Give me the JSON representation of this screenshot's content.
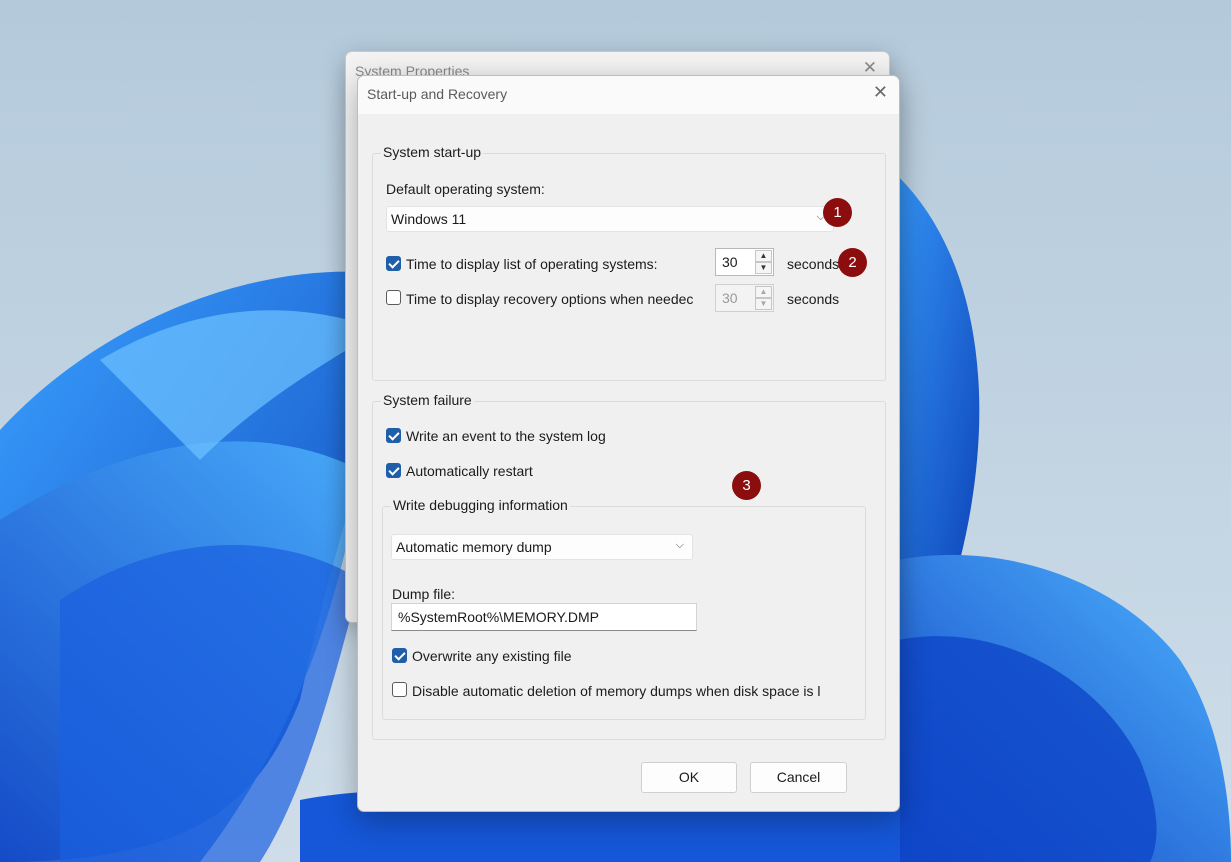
{
  "background_dialog": {
    "title": "System Properties",
    "close_glyph": "✕"
  },
  "dialog": {
    "title": "Start-up and Recovery",
    "close_glyph": "✕",
    "startup": {
      "legend": "System start-up",
      "default_os_label": "Default operating system:",
      "default_os_value": "Windows 11",
      "display_list": {
        "checked": true,
        "label": "Time to display list of operating systems:",
        "value": "30",
        "unit": "seconds"
      },
      "recovery_options": {
        "checked": false,
        "label": "Time to display recovery options when needec",
        "value": "30",
        "unit": "seconds"
      }
    },
    "failure": {
      "legend": "System failure",
      "write_event": {
        "checked": true,
        "label": "Write an event to the system log"
      },
      "auto_restart": {
        "checked": true,
        "label": "Automatically restart"
      },
      "debug": {
        "legend": "Write debugging information",
        "type_value": "Automatic memory dump",
        "dump_file_label": "Dump file:",
        "dump_file_value": "%SystemRoot%\\MEMORY.DMP",
        "overwrite": {
          "checked": true,
          "label": "Overwrite any existing file"
        },
        "disable_deletion": {
          "checked": false,
          "label": "Disable automatic deletion of memory dumps when disk space is l"
        }
      }
    },
    "buttons": {
      "ok": "OK",
      "cancel": "Cancel"
    }
  },
  "annotations": [
    "1",
    "2",
    "3"
  ],
  "colors": {
    "accent": "#1f5ea9",
    "badge": "#8c0d0d",
    "wallpaper_blue": "#1a5fe0"
  },
  "icons": {
    "chevron": "chevron-down-icon",
    "close": "close-icon",
    "spin_up": "spin-up-icon",
    "spin_down": "spin-down-icon"
  }
}
